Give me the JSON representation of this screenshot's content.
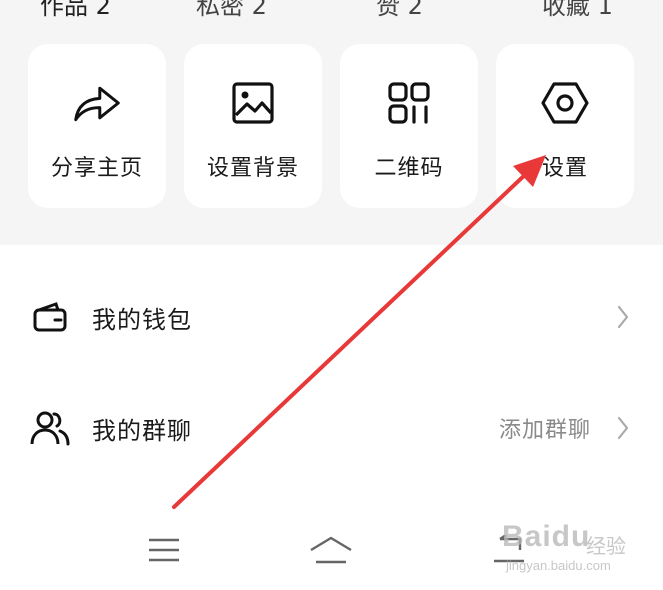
{
  "top_tabs": [
    "作品 2",
    "私密 2",
    "赞 2",
    "收藏 1"
  ],
  "quick_actions": [
    {
      "label": "分享主页",
      "icon": "share-icon"
    },
    {
      "label": "设置背景",
      "icon": "image-icon"
    },
    {
      "label": "二维码",
      "icon": "qr-code-icon"
    },
    {
      "label": "设置",
      "icon": "settings-icon"
    }
  ],
  "menu": {
    "wallet": {
      "label": "我的钱包",
      "icon": "wallet-icon"
    },
    "groups": {
      "label": "我的群聊",
      "extra": "添加群聊",
      "icon": "people-icon"
    }
  },
  "navbar": {
    "items": [
      "menu-icon",
      "home-icon",
      "back-icon"
    ]
  },
  "watermark": {
    "brand": "Baidu",
    "sub": "经验",
    "url": "jingyan.baidu.com"
  },
  "colors": {
    "panel_bg": "#f5f5f5",
    "card_bg": "#ffffff",
    "arrow": "#e83838",
    "secondary_text": "#8a8a8a"
  }
}
